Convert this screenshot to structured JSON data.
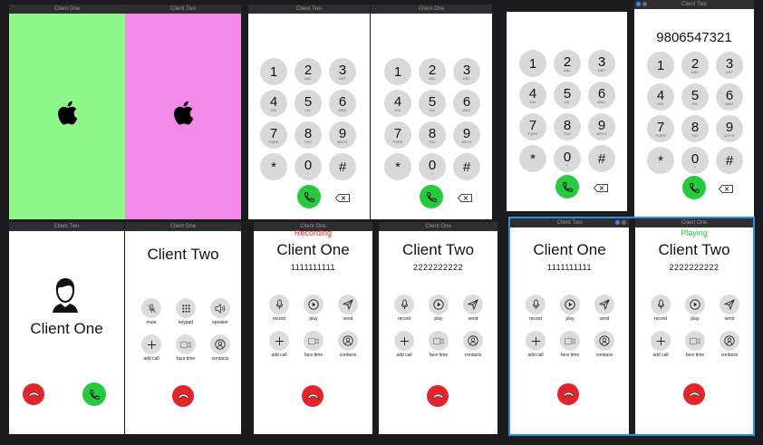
{
  "titles": {
    "client_one": "Client One",
    "client_two": "Client Two"
  },
  "colors": {
    "green_screen": "#8ff78a",
    "pink_screen": "#f28ae8",
    "call_green": "#27c93f",
    "end_red": "#e3242b",
    "key_gray": "#d9d9d9",
    "select_blue": "#2f8ee8"
  },
  "keys": [
    {
      "d": "1",
      "l": ""
    },
    {
      "d": "2",
      "l": "ABC"
    },
    {
      "d": "3",
      "l": "DEF"
    },
    {
      "d": "4",
      "l": "GHI"
    },
    {
      "d": "5",
      "l": "JKL"
    },
    {
      "d": "6",
      "l": "MNO"
    },
    {
      "d": "7",
      "l": "PQRS"
    },
    {
      "d": "8",
      "l": "TUV"
    },
    {
      "d": "9",
      "l": "WXYZ"
    },
    {
      "d": "*",
      "l": ""
    },
    {
      "d": "0",
      "l": "+"
    },
    {
      "d": "#",
      "l": ""
    }
  ],
  "dialed_number": "9806547321",
  "incoming": {
    "caller_name": "Client One"
  },
  "call_menu": {
    "callee": "Client Two",
    "mute": "mute",
    "keypad": "keypad",
    "speaker": "speaker",
    "add_call": "add call",
    "face_time": "face time",
    "contacts": "contacts"
  },
  "recording": {
    "status": "Recording",
    "left_name": "Client One",
    "left_number": "1111111111",
    "right_name": "Client Two",
    "right_number": "2222222222",
    "record": "record",
    "play": "play",
    "send": "send",
    "add_call": "add call",
    "face_time": "face time",
    "contacts": "contacts"
  },
  "playing": {
    "status": "Playing",
    "left_name": "Client One",
    "left_number": "1111111111",
    "right_name": "Client Two",
    "right_number": "2222222222",
    "record": "record",
    "play": "play",
    "send": "send",
    "add_call": "add call",
    "face_time": "face time",
    "contacts": "contacts"
  }
}
